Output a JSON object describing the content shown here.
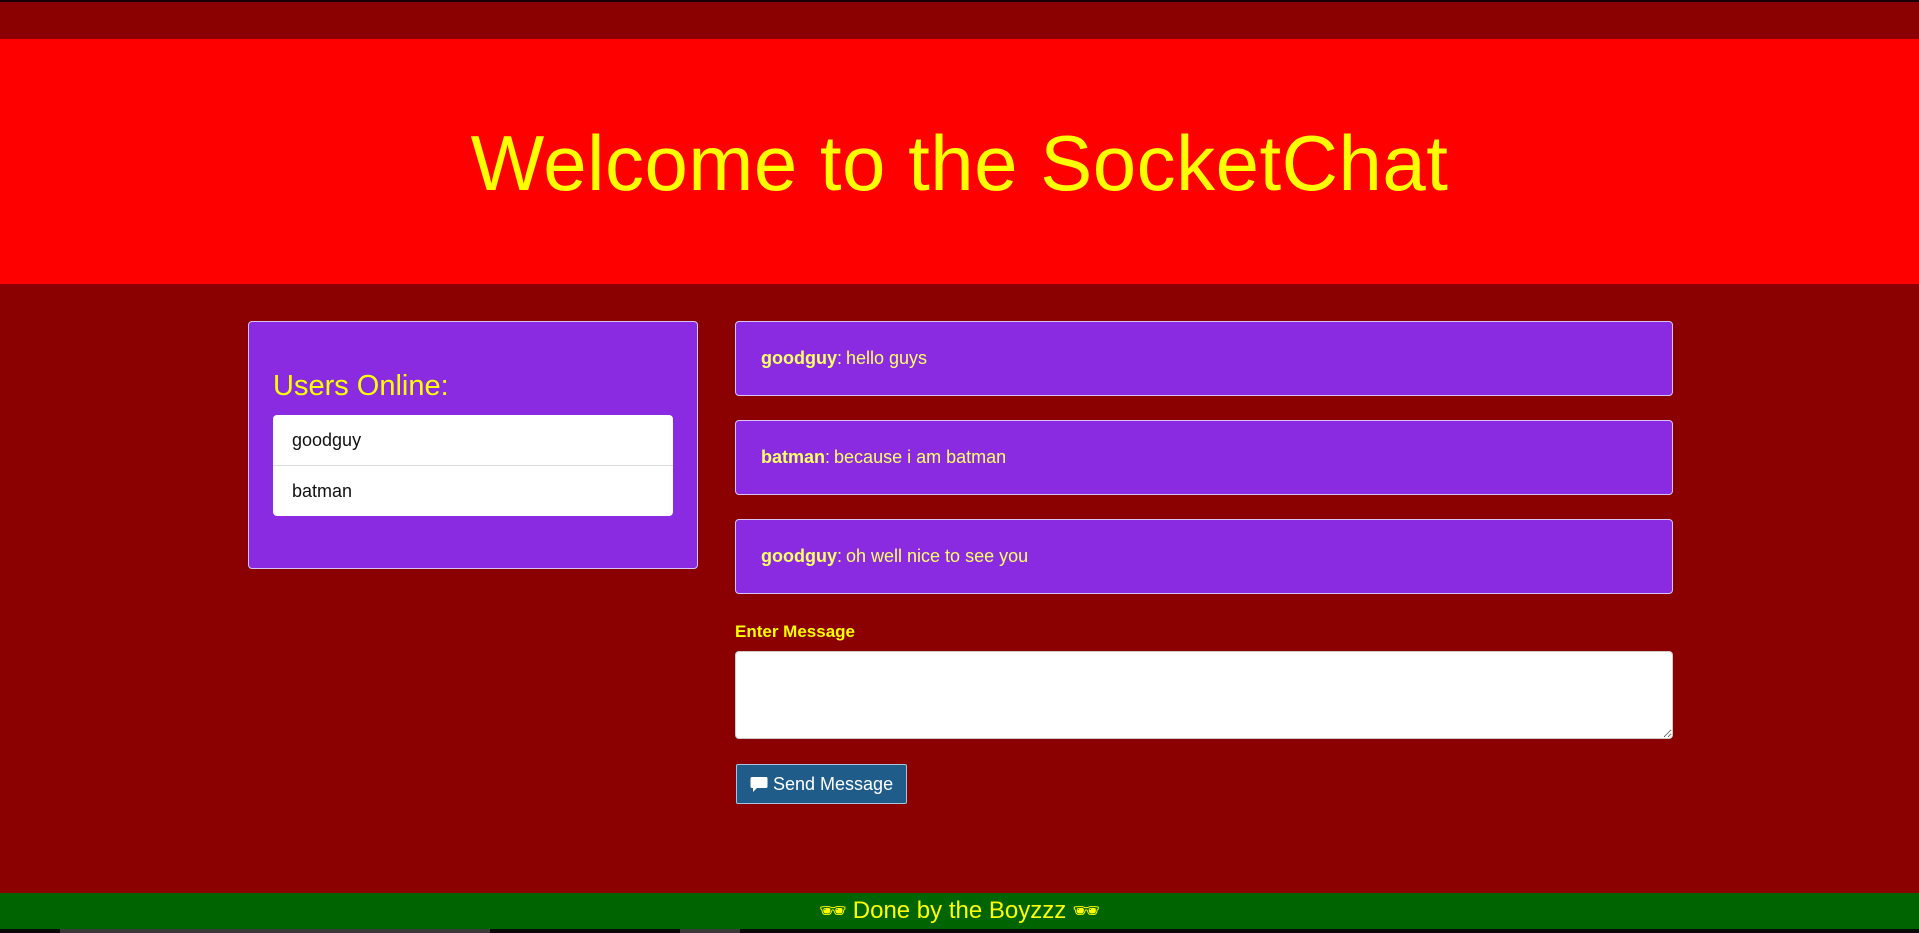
{
  "header": {
    "title": "Welcome to the SocketChat"
  },
  "users_panel": {
    "heading": "Users Online:",
    "users": [
      "goodguy",
      "batman"
    ]
  },
  "messages": [
    {
      "user": "goodguy",
      "text": "hello guys"
    },
    {
      "user": "batman",
      "text": "because i am batman"
    },
    {
      "user": "goodguy",
      "text": "oh well nice to see you"
    }
  ],
  "compose": {
    "label": "Enter Message",
    "value": "",
    "send_label": "Send Message",
    "send_icon": "comment-icon"
  },
  "footer": {
    "text": "Done by the Boyzzz",
    "glasses_left": "🕶",
    "glasses_right": "🕶"
  },
  "colors": {
    "page_bg": "#8b0000",
    "hero_bg": "#ff0000",
    "accent_text": "#ffff00",
    "panel_bg": "#8a2be2",
    "button_bg": "#1f5c8a",
    "footer_bg": "#006400"
  }
}
